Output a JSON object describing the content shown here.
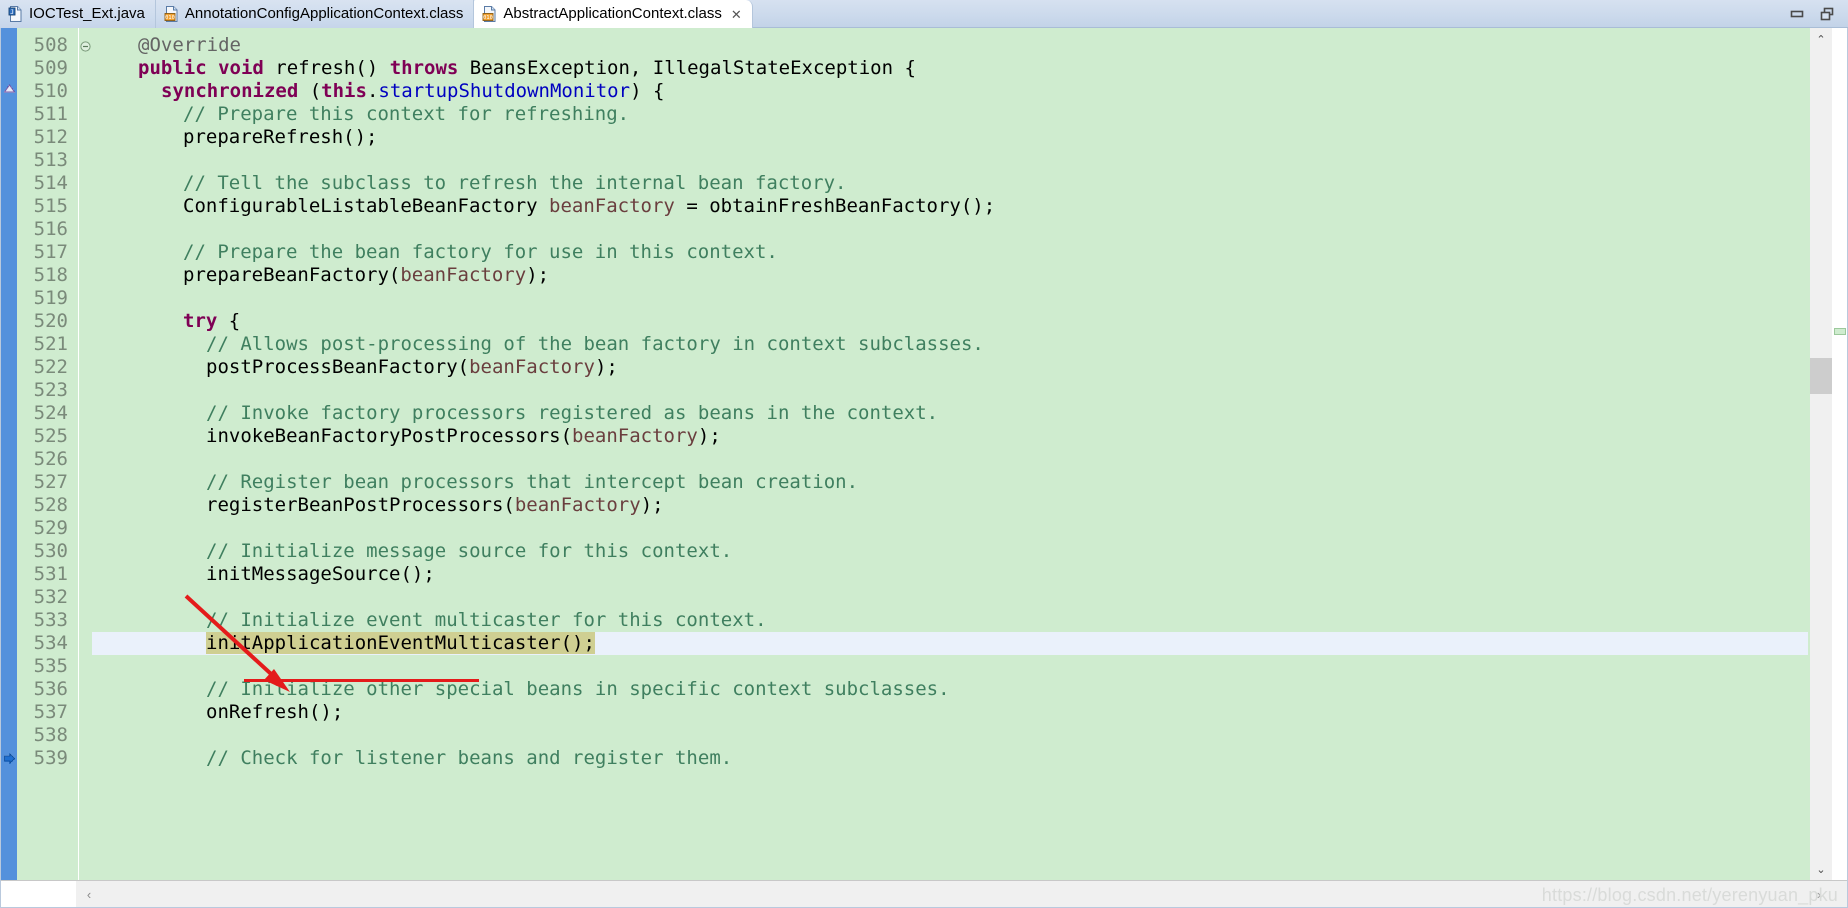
{
  "window": {
    "minimize_label": "Minimize",
    "restore_label": "Restore"
  },
  "tabs": [
    {
      "label": "IOCTest_Ext.java",
      "icon": "java-file-icon",
      "active": false,
      "closable": false
    },
    {
      "label": "AnnotationConfigApplicationContext.class",
      "icon": "class-file-icon",
      "active": false,
      "closable": false
    },
    {
      "label": "AbstractApplicationContext.class",
      "icon": "class-file-icon",
      "active": true,
      "closable": true,
      "close_glyph": "✕"
    }
  ],
  "editor": {
    "first_line": 508,
    "current_line": 534,
    "fold_marker_line": 508,
    "fold_glyph": "⊖",
    "lines": [
      {
        "n": 508,
        "indent": 4,
        "tokens": [
          {
            "t": "ann",
            "s": "@Override"
          }
        ]
      },
      {
        "n": 509,
        "indent": 4,
        "tokens": [
          {
            "t": "kw",
            "s": "public"
          },
          {
            "t": "plain",
            "s": " "
          },
          {
            "t": "kw",
            "s": "void"
          },
          {
            "t": "plain",
            "s": " refresh() "
          },
          {
            "t": "kw",
            "s": "throws"
          },
          {
            "t": "plain",
            "s": " BeansException, IllegalStateException {"
          }
        ]
      },
      {
        "n": 510,
        "indent": 6,
        "tokens": [
          {
            "t": "kw",
            "s": "synchronized"
          },
          {
            "t": "plain",
            "s": " ("
          },
          {
            "t": "kw",
            "s": "this"
          },
          {
            "t": "plain",
            "s": "."
          },
          {
            "t": "fld",
            "s": "startupShutdownMonitor"
          },
          {
            "t": "plain",
            "s": ") {"
          }
        ]
      },
      {
        "n": 511,
        "indent": 8,
        "tokens": [
          {
            "t": "cmt",
            "s": "// Prepare this context for refreshing."
          }
        ]
      },
      {
        "n": 512,
        "indent": 8,
        "tokens": [
          {
            "t": "plain",
            "s": "prepareRefresh();"
          }
        ]
      },
      {
        "n": 513,
        "indent": 0,
        "tokens": []
      },
      {
        "n": 514,
        "indent": 8,
        "tokens": [
          {
            "t": "cmt",
            "s": "// Tell the subclass to refresh the internal bean factory."
          }
        ]
      },
      {
        "n": 515,
        "indent": 8,
        "tokens": [
          {
            "t": "plain",
            "s": "ConfigurableListableBeanFactory "
          },
          {
            "t": "loc",
            "s": "beanFactory"
          },
          {
            "t": "plain",
            "s": " = obtainFreshBeanFactory();"
          }
        ]
      },
      {
        "n": 516,
        "indent": 0,
        "tokens": []
      },
      {
        "n": 517,
        "indent": 8,
        "tokens": [
          {
            "t": "cmt",
            "s": "// Prepare the bean factory for use in this context."
          }
        ]
      },
      {
        "n": 518,
        "indent": 8,
        "tokens": [
          {
            "t": "plain",
            "s": "prepareBeanFactory("
          },
          {
            "t": "loc",
            "s": "beanFactory"
          },
          {
            "t": "plain",
            "s": ");"
          }
        ]
      },
      {
        "n": 519,
        "indent": 0,
        "tokens": []
      },
      {
        "n": 520,
        "indent": 8,
        "tokens": [
          {
            "t": "kw",
            "s": "try"
          },
          {
            "t": "plain",
            "s": " {"
          }
        ]
      },
      {
        "n": 521,
        "indent": 10,
        "tokens": [
          {
            "t": "cmt",
            "s": "// Allows post-processing of the bean factory in context subclasses."
          }
        ]
      },
      {
        "n": 522,
        "indent": 10,
        "tokens": [
          {
            "t": "plain",
            "s": "postProcessBeanFactory("
          },
          {
            "t": "loc",
            "s": "beanFactory"
          },
          {
            "t": "plain",
            "s": ");"
          }
        ]
      },
      {
        "n": 523,
        "indent": 0,
        "tokens": []
      },
      {
        "n": 524,
        "indent": 10,
        "tokens": [
          {
            "t": "cmt",
            "s": "// Invoke factory processors registered as beans in the context."
          }
        ]
      },
      {
        "n": 525,
        "indent": 10,
        "tokens": [
          {
            "t": "plain",
            "s": "invokeBeanFactoryPostProcessors("
          },
          {
            "t": "loc",
            "s": "beanFactory"
          },
          {
            "t": "plain",
            "s": ");"
          }
        ]
      },
      {
        "n": 526,
        "indent": 0,
        "tokens": []
      },
      {
        "n": 527,
        "indent": 10,
        "tokens": [
          {
            "t": "cmt",
            "s": "// Register bean processors that intercept bean creation."
          }
        ]
      },
      {
        "n": 528,
        "indent": 10,
        "tokens": [
          {
            "t": "plain",
            "s": "registerBeanPostProcessors("
          },
          {
            "t": "loc",
            "s": "beanFactory"
          },
          {
            "t": "plain",
            "s": ");"
          }
        ]
      },
      {
        "n": 529,
        "indent": 0,
        "tokens": []
      },
      {
        "n": 530,
        "indent": 10,
        "tokens": [
          {
            "t": "cmt",
            "s": "// Initialize message source for this context."
          }
        ]
      },
      {
        "n": 531,
        "indent": 10,
        "tokens": [
          {
            "t": "plain",
            "s": "initMessageSource();"
          }
        ]
      },
      {
        "n": 532,
        "indent": 0,
        "tokens": []
      },
      {
        "n": 533,
        "indent": 10,
        "tokens": [
          {
            "t": "cmt",
            "s": "// Initialize event multicaster for this context."
          }
        ]
      },
      {
        "n": 534,
        "indent": 10,
        "tokens": [
          {
            "t": "sel",
            "s": "initApplicationEventMulticaster();"
          }
        ]
      },
      {
        "n": 535,
        "indent": 0,
        "tokens": []
      },
      {
        "n": 536,
        "indent": 10,
        "tokens": [
          {
            "t": "cmt",
            "s": "// Initialize other special beans in specific context subclasses."
          }
        ]
      },
      {
        "n": 537,
        "indent": 10,
        "tokens": [
          {
            "t": "plain",
            "s": "onRefresh();"
          }
        ]
      },
      {
        "n": 538,
        "indent": 0,
        "tokens": []
      },
      {
        "n": 539,
        "indent": 10,
        "tokens": [
          {
            "t": "cmt",
            "s": "// Check for listener beans and register them."
          }
        ]
      }
    ],
    "annotations": {
      "red_underline_target": "initMessageSource()",
      "red_arrow_target": "initApplicationEventMulticaster();",
      "accent_color": "#e41b1b"
    },
    "colors": {
      "background": "#cfeccf",
      "current_line": "#eaf1fb",
      "selection": "#cfcf92",
      "keyword": "#7f0055",
      "comment": "#3f7f5f",
      "field": "#0000c0",
      "local_var": "#6a3e3e",
      "annotation": "#646464"
    }
  },
  "scrollbars": {
    "vertical_up_glyph": "⌃",
    "vertical_down_glyph": "⌄",
    "horizontal_left_glyph": "‹",
    "horizontal_right_glyph": "›"
  },
  "watermark": "https://blog.csdn.net/yerenyuan_pku"
}
